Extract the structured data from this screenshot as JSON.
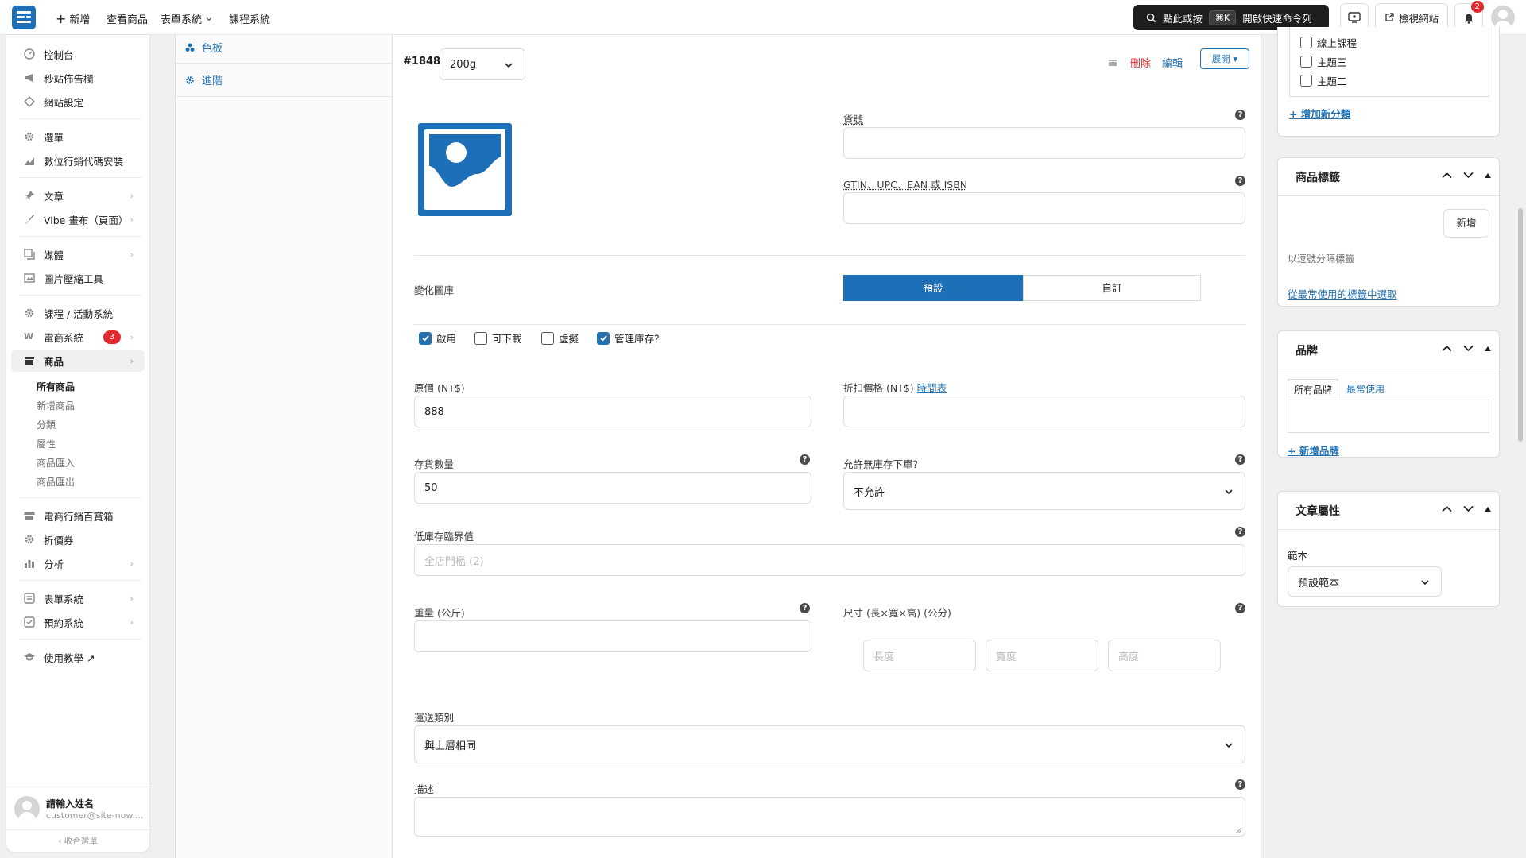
{
  "topbar": {
    "new_label": "新增",
    "view_products": "查看商品",
    "forms_system": "表單系統",
    "course_system": "課程系統",
    "command": {
      "prefix": "點此或按",
      "shortcut": "⌘K",
      "suffix": "開啟快速命令列"
    },
    "view_site": "檢視網站",
    "notifications_count": "2"
  },
  "sidebar": {
    "items": [
      {
        "label": "控制台",
        "icon": "dashboard-icon"
      },
      {
        "label": "秒站佈告欄",
        "icon": "megaphone-icon"
      },
      {
        "label": "網站設定",
        "icon": "settings-diamond-icon"
      },
      {
        "label": "選單",
        "icon": "gear-icon"
      },
      {
        "label": "數位行銷代碼安裝",
        "icon": "analytics-icon"
      },
      {
        "label": "文章",
        "icon": "pin-icon"
      },
      {
        "label": "Vibe 畫布（頁面）",
        "icon": "brush-icon"
      },
      {
        "label": "媒體",
        "icon": "media-icon"
      },
      {
        "label": "圖片壓縮工具",
        "icon": "image-icon"
      },
      {
        "label": "課程 / 活動系統",
        "icon": "gear-icon"
      },
      {
        "label": "電商系統",
        "icon": "woo-icon",
        "badge": "3"
      },
      {
        "label": "商品",
        "icon": "archive-icon"
      },
      {
        "label": "電商行銷百寶箱",
        "icon": "store-icon"
      },
      {
        "label": "折價券",
        "icon": "gear-icon"
      },
      {
        "label": "分析",
        "icon": "chart-icon"
      },
      {
        "label": "表單系統",
        "icon": "form-icon"
      },
      {
        "label": "預約系統",
        "icon": "booking-icon"
      },
      {
        "label": "使用教學 ↗",
        "icon": "education-icon"
      }
    ],
    "products_sub": [
      "所有商品",
      "新增商品",
      "分類",
      "屬性",
      "商品匯入",
      "商品匯出"
    ],
    "user": {
      "name": "請輸入姓名",
      "email": "customer@site-now...."
    },
    "collapse": "收合選單"
  },
  "tabs": [
    {
      "label": "色板",
      "icon": "swatch-icon"
    },
    {
      "label": "進階",
      "icon": "gear-icon"
    }
  ],
  "variation": {
    "id": "#1848",
    "selected": "200g",
    "menu_icon": "menu-icon",
    "delete": "刪除",
    "edit": "編輯",
    "expand": "展開 ▾"
  },
  "form": {
    "sku_label": "貨號",
    "gtin_label": "GTIN、UPC、EAN 或 ISBN",
    "gallery_label": "變化圖庫",
    "gallery_options": [
      "預設",
      "自訂"
    ],
    "checks": [
      {
        "label": "啟用",
        "checked": true
      },
      {
        "label": "可下載",
        "checked": false
      },
      {
        "label": "虛擬",
        "checked": false
      },
      {
        "label": "管理庫存？",
        "checked": true
      }
    ],
    "regular_price_label": "原價 (NT$)",
    "regular_price": "888",
    "sale_price_label": "折扣價格 (NT$)",
    "schedule_link": "時間表",
    "stock_label": "存貨數量",
    "stock": "50",
    "backorder_label": "允許無庫存下單？",
    "backorder_value": "不允許",
    "low_stock_label": "低庫存臨界值",
    "low_stock_placeholder": "全店門檻 (2)",
    "weight_label": "重量 (公斤)",
    "dimensions_label": "尺寸 (長×寬×高) (公分)",
    "length_ph": "長度",
    "width_ph": "寬度",
    "height_ph": "高度",
    "shipping_label": "運送類別",
    "shipping_value": "與上層相同",
    "description_label": "描述"
  },
  "right": {
    "categories": [
      "線上課程",
      "主題三",
      "主題二"
    ],
    "add_category": "+ 增加新分類",
    "tags": {
      "title": "商品標籤",
      "add_button": "新增",
      "hint": "以逗號分隔標籤",
      "choose_link": "從最常使用的標籤中選取"
    },
    "brand": {
      "title": "品牌",
      "tab_all": "所有品牌",
      "tab_common": "最常使用",
      "add_link": "+ 新增品牌"
    },
    "attrs": {
      "title": "文章屬性",
      "template_label": "範本",
      "template_value": "預設範本"
    }
  },
  "colors": {
    "accent": "#2271b1",
    "danger": "#e0282e",
    "brand": "#1d6fb8"
  }
}
